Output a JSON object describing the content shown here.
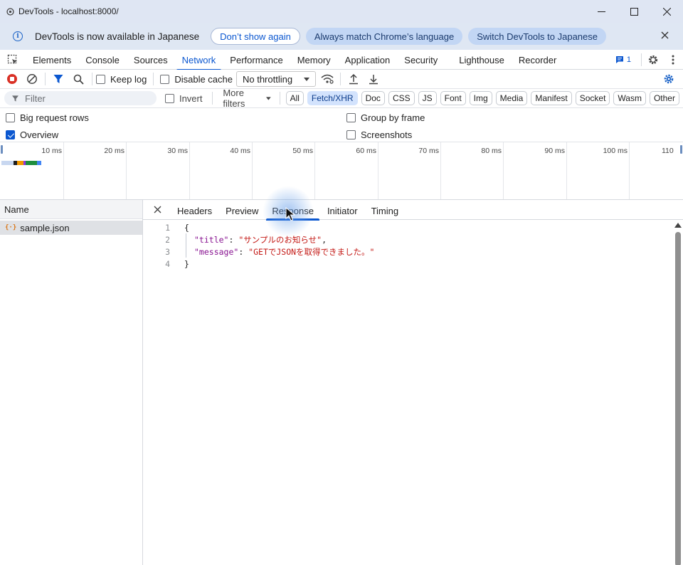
{
  "window": {
    "title": "DevTools - localhost:8000/"
  },
  "infobar": {
    "message": "DevTools is now available in Japanese",
    "dont_show_again": "Don’t show again",
    "always_match": "Always match Chrome’s language",
    "switch_language": "Switch DevTools to Japanese"
  },
  "main_tabs": [
    "Elements",
    "Console",
    "Sources",
    "Network",
    "Performance",
    "Memory",
    "Application",
    "Security",
    "Lighthouse",
    "Recorder"
  ],
  "active_main_tab": "Network",
  "issues_count": "1",
  "toolbar": {
    "keep_log": "Keep log",
    "disable_cache": "Disable cache",
    "throttling": "No throttling"
  },
  "filter": {
    "placeholder": "Filter",
    "invert": "Invert",
    "more_filters": "More filters",
    "types": [
      "All",
      "Fetch/XHR",
      "Doc",
      "CSS",
      "JS",
      "Font",
      "Img",
      "Media",
      "Manifest",
      "Socket",
      "Wasm",
      "Other"
    ],
    "active_type": "Fetch/XHR"
  },
  "options": {
    "big_request_rows": "Big request rows",
    "overview": "Overview",
    "group_by_frame": "Group by frame",
    "screenshots": "Screenshots",
    "overview_checked": true
  },
  "timeline": {
    "ticks": [
      "10 ms",
      "20 ms",
      "30 ms",
      "40 ms",
      "50 ms",
      "60 ms",
      "70 ms",
      "80 ms",
      "90 ms",
      "100 ms",
      "110"
    ]
  },
  "requests": {
    "column_name": "Name",
    "items": [
      {
        "name": "sample.json"
      }
    ]
  },
  "detail_tabs": [
    "Headers",
    "Preview",
    "Response",
    "Initiator",
    "Timing"
  ],
  "active_detail_tab": "Response",
  "response": {
    "lines": [
      {
        "num": "1",
        "text": "{"
      },
      {
        "num": "2",
        "key": "\"title\"",
        "value": "\"サンプルのお知らせ\"",
        "trail": ","
      },
      {
        "num": "3",
        "key": "\"message\"",
        "value": "\"GETでJSONを取得できました。\"",
        "trail": ""
      },
      {
        "num": "4",
        "text": "}"
      }
    ]
  },
  "colors": {
    "accent": "#0b57d0",
    "title_bar": "#dfe6f3",
    "json_key": "#881391",
    "json_string": "#c41a16"
  }
}
